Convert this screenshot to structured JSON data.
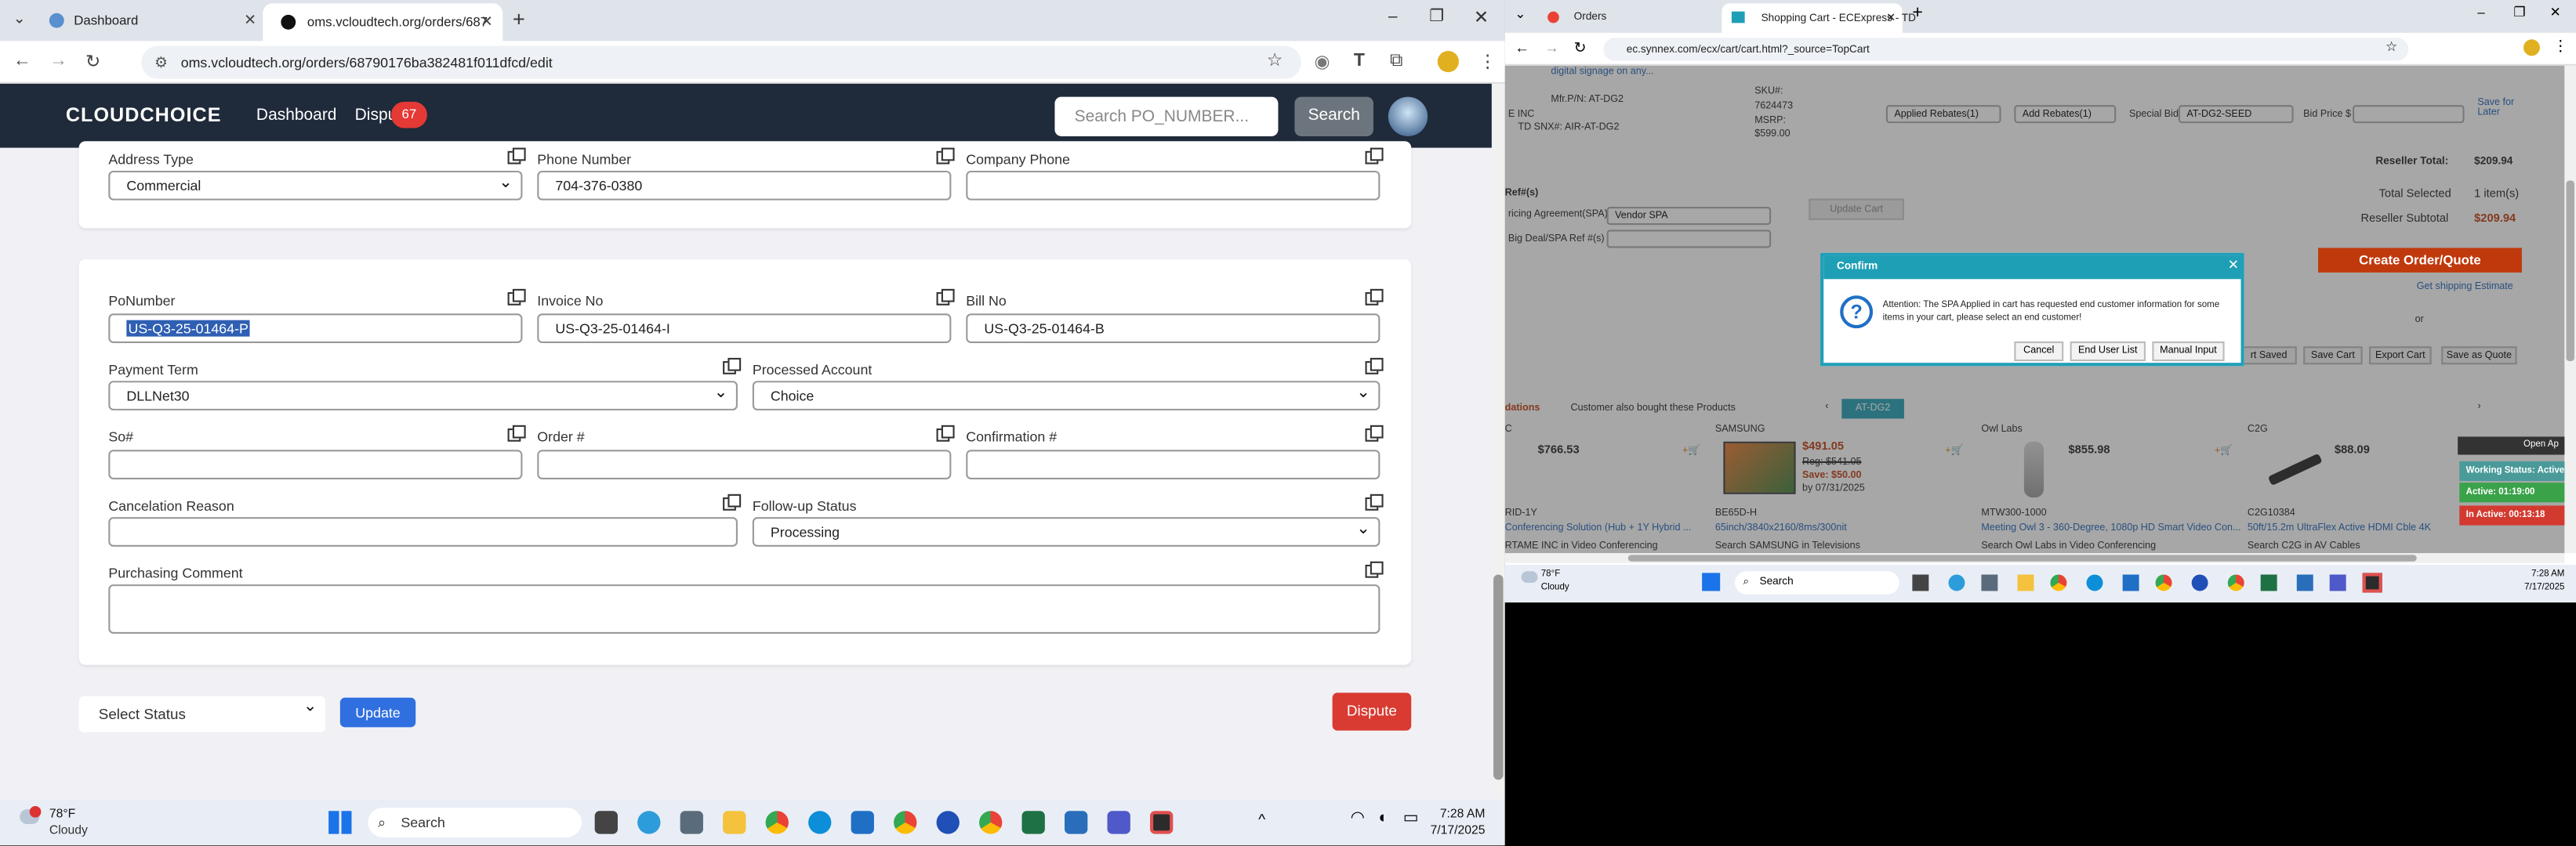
{
  "left_browser": {
    "tabs": [
      {
        "label": "Dashboard"
      },
      {
        "label": "oms.vcloudtech.org/orders/687"
      }
    ],
    "url": "oms.vcloudtech.org/orders/68790176ba382481f011dfcd/edit"
  },
  "app": {
    "brand": "CLOUDCHOICE",
    "nav": {
      "dashboard": "Dashboard",
      "dispute": "Dispu",
      "dispute_badge": "67"
    },
    "search_placeholder": "Search PO_NUMBER...",
    "search_button": "Search"
  },
  "address_section": {
    "address_type_label": "Address Type",
    "address_type_value": "Commercial",
    "phone_label": "Phone Number",
    "phone_value": "704-376-0380",
    "company_phone_label": "Company Phone",
    "company_phone_value": ""
  },
  "order_section": {
    "po_label": "PoNumber",
    "po_value": "US-Q3-25-01464-P",
    "invoice_label": "Invoice No",
    "invoice_value": "US-Q3-25-01464-I",
    "bill_label": "Bill No",
    "bill_value": "US-Q3-25-01464-B",
    "payment_term_label": "Payment Term",
    "payment_term_value": "DLLNet30",
    "processed_account_label": "Processed Account",
    "processed_account_value": "Choice",
    "so_label": "So#",
    "order_label": "Order #",
    "confirmation_label": "Confirmation #",
    "cancel_reason_label": "Cancelation Reason",
    "followup_label": "Follow-up Status",
    "followup_value": "Processing",
    "purchasing_comment_label": "Purchasing Comment"
  },
  "actions": {
    "status_select": "Select Status",
    "update": "Update",
    "dispute": "Dispute"
  },
  "left_taskbar": {
    "weather_temp": "78°F",
    "weather_desc": "Cloudy",
    "search": "Search",
    "time": "7:28 AM",
    "date": "7/17/2025"
  },
  "right_browser": {
    "tabs": [
      {
        "label": "Orders"
      },
      {
        "label": "Shopping Cart - ECExpress - TD"
      }
    ],
    "url": "ec.synnex.com/ecx/cart/cart.html?_source=TopCart"
  },
  "cart": {
    "digital_signage": "digital signage on any...",
    "mfr_pn": "Mfr.P/N: AT-DG2",
    "td_snx": "TD SNX#: AIR-AT-DG2",
    "inc": "E INC",
    "sku_label": "SKU#:",
    "sku_value": "7624473",
    "msrp_label": "MSRP:",
    "msrp_value": "$599.00",
    "applied_rebates": "Applied Rebates(1)",
    "add_rebates": "Add Rebates(1)",
    "special_bid_label": "Special Bid#",
    "special_bid_value": "AT-DG2-SEED",
    "bid_price_label": "Bid Price $",
    "save_for_later": "Save for Later",
    "reseller_total_label": "Reseller Total:",
    "reseller_total_value": "$209.94",
    "ref": "Ref#(s)",
    "pricing_agreement": "ricing Agreement(SPA)",
    "vendor_spa": "Vendor SPA",
    "big_deal": "Big Deal/SPA Ref #(s)",
    "update_cart": "Update Cart",
    "total_selected_label": "Total Selected",
    "total_selected_value": "1 item(s)",
    "reseller_subtotal_label": "Reseller Subtotal",
    "reseller_subtotal_value": "$209.94",
    "create_order": "Create Order/Quote",
    "shipping_estimate": "Get shipping Estimate",
    "or": "or",
    "cart_saved": "rt Saved",
    "save_cart": "Save Cart",
    "export_cart": "Export Cart",
    "save_as_quote": "Save as Quote",
    "recommendations": "dations",
    "also_bought": "Customer also bought these Products",
    "tab_atdg2": "AT-DG2"
  },
  "products": [
    {
      "brand": "C",
      "price": "$766.53",
      "sku": "RID-1Y",
      "desc": "Conferencing Solution (Hub + 1Y Hybrid ...",
      "search": "RTAME INC in  Video Conferencing"
    },
    {
      "brand": "SAMSUNG",
      "price": "$491.05",
      "reg": "Reg: $541.05",
      "save": "Save: $50.00",
      "until": "by 07/31/2025",
      "sku": "BE65D-H",
      "desc": "65inch/3840x2160/8ms/300nit",
      "search": "Search SAMSUNG in  Televisions"
    },
    {
      "brand": "Owl Labs",
      "price": "$855.98",
      "sku": "MTW300-1000",
      "desc": "Meeting Owl 3 - 360-Degree, 1080p HD Smart Video Con...",
      "search": "Search Owl Labs in  Video Conferencing"
    },
    {
      "brand": "C2G",
      "price": "$88.09",
      "sku": "C2G10384",
      "desc": "50ft/15.2m UltraFlex Active HDMI Cble 4K",
      "search": "Search C2G in  AV Cables"
    }
  ],
  "modal": {
    "title": "Confirm",
    "message": "Attention: The SPA Applied in cart has requested end customer information for some items in your cart, please select an end customer!",
    "cancel": "Cancel",
    "end_user_list": "End User List",
    "manual_input": "Manual Input"
  },
  "work_status": {
    "open_app": "Open Ap",
    "working": "Working Status: Active",
    "active": "Active: 01:19:00",
    "inactive": "In Active: 00:13:18"
  },
  "right_taskbar": {
    "weather_temp": "78°F",
    "weather_desc": "Cloudy",
    "search": "Search",
    "time": "7:28 AM",
    "date": "7/17/2025"
  },
  "colors": {
    "navbar": "#1f2a3a",
    "primary": "#2f6fe0",
    "danger": "#d93a31",
    "modal_accent": "#1f9fb5",
    "create_order": "#c0390c"
  }
}
